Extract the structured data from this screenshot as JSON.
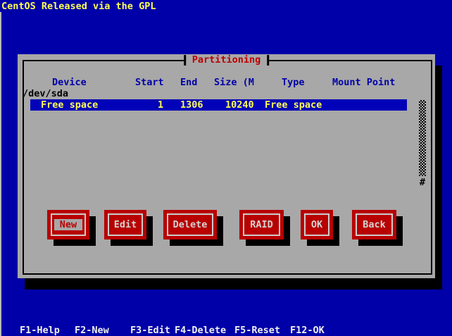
{
  "screen": {
    "title": "CentOS Released via the GPL"
  },
  "dialog": {
    "title": "Partitioning",
    "table": {
      "headers": [
        "Device",
        "Start",
        "End",
        "Size (M",
        "Type",
        "Mount Point"
      ],
      "group_row": "/dev/sda",
      "selected_row": {
        "device": "Free space",
        "start": "1",
        "end": "1306",
        "size": "10240",
        "type": "Free space",
        "mount_point": ""
      }
    },
    "scrollbar": {
      "thumb": "#"
    },
    "buttons": [
      {
        "label": "New",
        "focused": true
      },
      {
        "label": "Edit",
        "focused": false
      },
      {
        "label": "Delete",
        "focused": false
      },
      {
        "label": "RAID",
        "focused": false
      },
      {
        "label": "OK",
        "focused": false
      },
      {
        "label": "Back",
        "focused": false
      }
    ]
  },
  "function_bar": {
    "items": [
      "F1-Help",
      "F2-New",
      "F3-Edit",
      "F4-Delete",
      "F5-Reset",
      "F12-OK"
    ]
  },
  "colors": {
    "background_blue": "#0000a8",
    "dialog_gray": "#a8a8a8",
    "accent_red": "#b80000",
    "highlight_yellow": "#ffff54",
    "selected_row_blue": "#0202b8",
    "header_blue": "#0000a8",
    "shadow_black": "#000000"
  }
}
